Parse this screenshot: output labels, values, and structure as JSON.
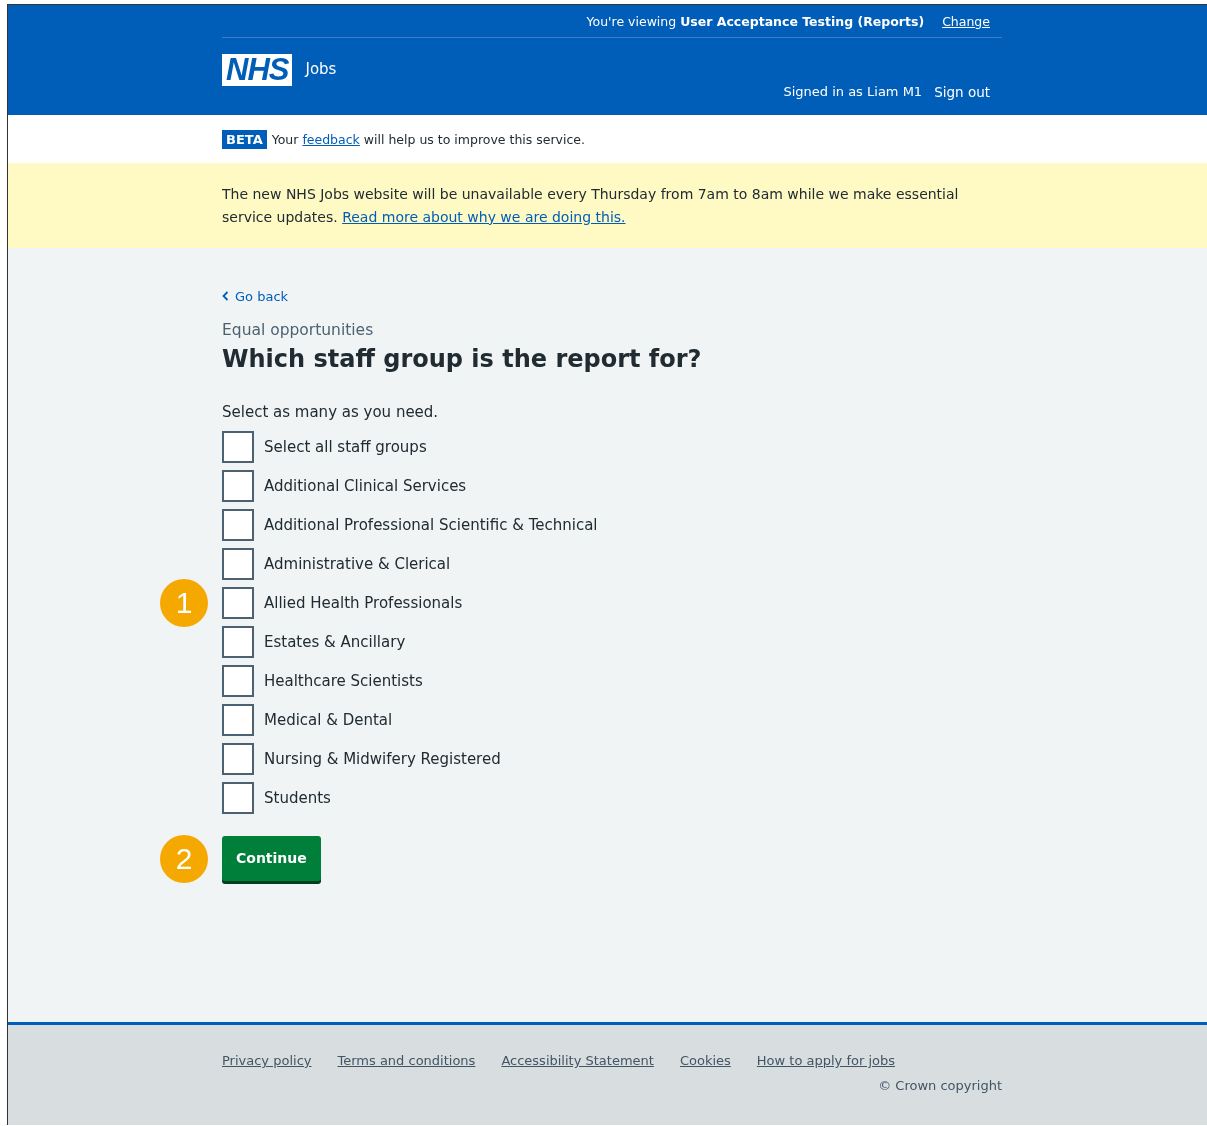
{
  "environment_bar": {
    "prefix": "You're viewing",
    "environment": "User Acceptance Testing (Reports)",
    "change_link": "Change"
  },
  "header": {
    "logo": "NHS",
    "service": "Jobs",
    "signed_in": "Signed in as Liam M1",
    "sign_out": "Sign out"
  },
  "beta_banner": {
    "tag": "BETA",
    "before": "Your",
    "link": "feedback",
    "after": "will help us to improve this service."
  },
  "notice": {
    "text": "The new NHS Jobs website will be unavailable every Thursday from 7am to 8am while we make essential service updates.",
    "link": "Read more about why we are doing this."
  },
  "back_link": "Go back",
  "caption": "Equal opportunities",
  "heading": "Which staff group is the report for?",
  "hint": "Select as many as you need.",
  "options": [
    {
      "label": "Select all staff groups",
      "checked": false
    },
    {
      "label": "Additional Clinical Services",
      "checked": false
    },
    {
      "label": "Additional Professional Scientific & Technical",
      "checked": false
    },
    {
      "label": "Administrative & Clerical",
      "checked": false
    },
    {
      "label": "Allied Health Professionals",
      "checked": false,
      "callout": "1"
    },
    {
      "label": "Estates & Ancillary",
      "checked": false
    },
    {
      "label": "Healthcare Scientists",
      "checked": false
    },
    {
      "label": "Medical & Dental",
      "checked": false
    },
    {
      "label": "Nursing & Midwifery Registered",
      "checked": false
    },
    {
      "label": "Students",
      "checked": false
    }
  ],
  "continue_button": {
    "label": "Continue",
    "callout": "2"
  },
  "footer": {
    "links": [
      "Privacy policy",
      "Terms and conditions",
      "Accessibility Statement",
      "Cookies",
      "How to apply for jobs"
    ],
    "copyright": "© Crown copyright"
  }
}
